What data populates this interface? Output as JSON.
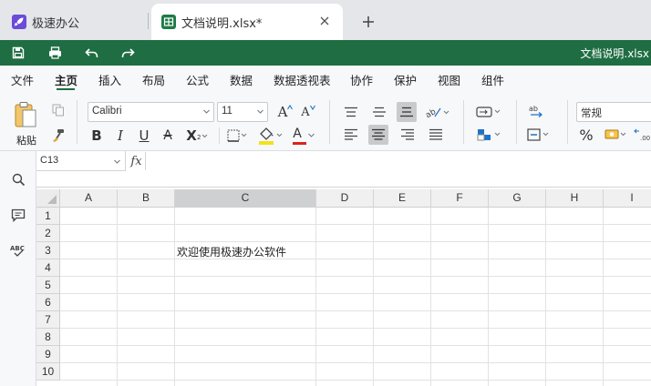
{
  "tabs": [
    {
      "label": "极速办公",
      "icon": "rocket-icon"
    },
    {
      "label": "文档说明.xlsx*",
      "icon": "spreadsheet-icon"
    }
  ],
  "colors": {
    "brand_green": "#1f6e43",
    "tab_bar": "#e4e6ea",
    "selected_header": "#cfd0d2"
  },
  "titlebar": {
    "doc_title": "文档说明.xlsx"
  },
  "menu": [
    "文件",
    "主页",
    "插入",
    "布局",
    "公式",
    "数据",
    "数据透视表",
    "协作",
    "保护",
    "视图",
    "组件"
  ],
  "menu_active": "主页",
  "ribbon": {
    "paste_label": "粘贴",
    "font_name": "Calibri",
    "font_size": "11",
    "bold": "B",
    "italic": "I",
    "underline": "U",
    "strike": "A",
    "subscript": "X",
    "number_format": "常规",
    "percent": "%",
    "font_grow": "A",
    "font_shrink": "A",
    "font_color": "A"
  },
  "formula_bar": {
    "cell_ref": "C13",
    "fx": "fx",
    "content": ""
  },
  "grid": {
    "columns": [
      "A",
      "B",
      "C",
      "D",
      "E",
      "F",
      "G",
      "H",
      "I"
    ],
    "selected_column": "C",
    "rows": [
      "1",
      "2",
      "3",
      "4",
      "5",
      "6",
      "7",
      "8",
      "9",
      "10"
    ],
    "cells": [
      {
        "ref": "C3",
        "value": "欢迎使用极速办公软件"
      }
    ]
  }
}
